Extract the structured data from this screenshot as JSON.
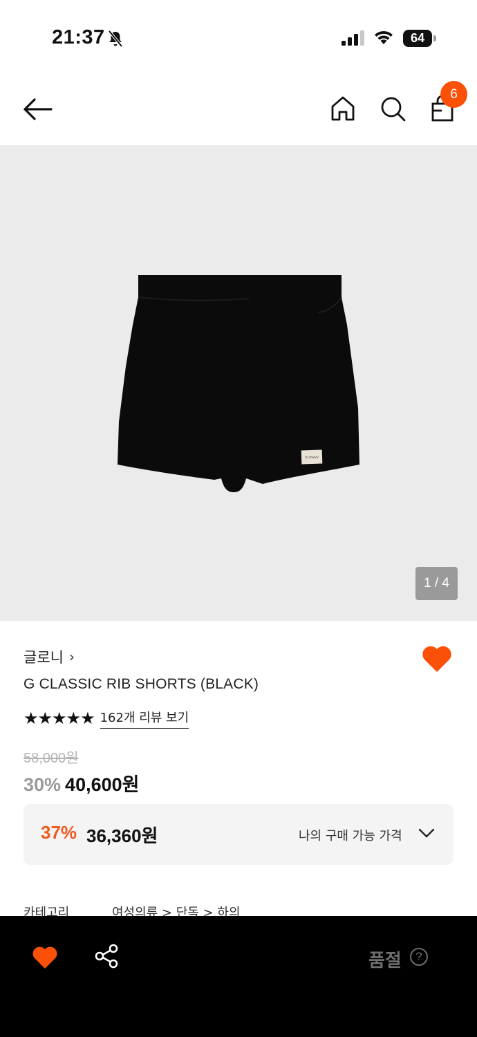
{
  "status_bar": {
    "time": "21:37",
    "battery": "64",
    "battery_level": 0.64
  },
  "header": {
    "cart_count": "6"
  },
  "gallery": {
    "counter": "1 / 4",
    "label_tag": "GLOWNY"
  },
  "product": {
    "brand": "글로니",
    "brand_chevron": "›",
    "name": "G CLASSIC RIB SHORTS (BLACK)",
    "rating_stars": 5,
    "stars_text": "★★★★★",
    "review_link": "162개 리뷰 보기",
    "original_price": "58,000원",
    "discount_rate": "30%",
    "sale_price": "40,600원"
  },
  "my_price": {
    "discount_rate": "37%",
    "price": "36,360원",
    "label": "나의 구매 가능 가격"
  },
  "category": {
    "label": "카테고리",
    "path": "여성의류 > 단독 > 하의"
  },
  "bottom_bar": {
    "soldout_label": "품절",
    "help_glyph": "?"
  },
  "colors": {
    "accent": "#fb5007",
    "discount_red": "#f05a1e"
  }
}
